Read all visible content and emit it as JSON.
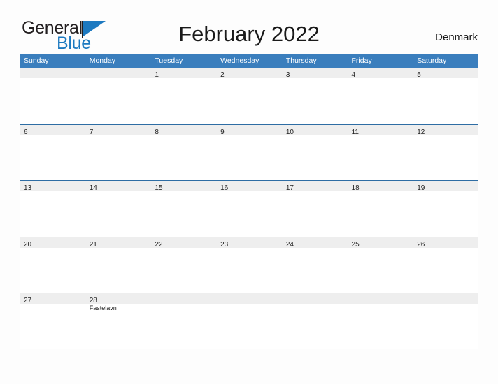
{
  "brand": {
    "name_part1": "General",
    "name_part2": "Blue",
    "flag_icon": "blue-flag-icon",
    "color_primary": "#1c79c0",
    "color_text": "#231f20"
  },
  "header": {
    "title": "February 2022",
    "region": "Denmark"
  },
  "calendar": {
    "header_bg": "#3a7ebd",
    "daynum_band_bg": "#eeeeee",
    "rule_color": "#2e6da4",
    "weekdays": [
      "Sunday",
      "Monday",
      "Tuesday",
      "Wednesday",
      "Thursday",
      "Friday",
      "Saturday"
    ],
    "weeks": [
      {
        "days": [
          {
            "number": "",
            "events": []
          },
          {
            "number": "",
            "events": []
          },
          {
            "number": "1",
            "events": []
          },
          {
            "number": "2",
            "events": []
          },
          {
            "number": "3",
            "events": []
          },
          {
            "number": "4",
            "events": []
          },
          {
            "number": "5",
            "events": []
          }
        ]
      },
      {
        "days": [
          {
            "number": "6",
            "events": []
          },
          {
            "number": "7",
            "events": []
          },
          {
            "number": "8",
            "events": []
          },
          {
            "number": "9",
            "events": []
          },
          {
            "number": "10",
            "events": []
          },
          {
            "number": "11",
            "events": []
          },
          {
            "number": "12",
            "events": []
          }
        ]
      },
      {
        "days": [
          {
            "number": "13",
            "events": []
          },
          {
            "number": "14",
            "events": []
          },
          {
            "number": "15",
            "events": []
          },
          {
            "number": "16",
            "events": []
          },
          {
            "number": "17",
            "events": []
          },
          {
            "number": "18",
            "events": []
          },
          {
            "number": "19",
            "events": []
          }
        ]
      },
      {
        "days": [
          {
            "number": "20",
            "events": []
          },
          {
            "number": "21",
            "events": []
          },
          {
            "number": "22",
            "events": []
          },
          {
            "number": "23",
            "events": []
          },
          {
            "number": "24",
            "events": []
          },
          {
            "number": "25",
            "events": []
          },
          {
            "number": "26",
            "events": []
          }
        ]
      },
      {
        "days": [
          {
            "number": "27",
            "events": []
          },
          {
            "number": "28",
            "events": [
              "Fastelavn"
            ]
          },
          {
            "number": "",
            "events": []
          },
          {
            "number": "",
            "events": []
          },
          {
            "number": "",
            "events": []
          },
          {
            "number": "",
            "events": []
          },
          {
            "number": "",
            "events": []
          }
        ]
      }
    ]
  }
}
